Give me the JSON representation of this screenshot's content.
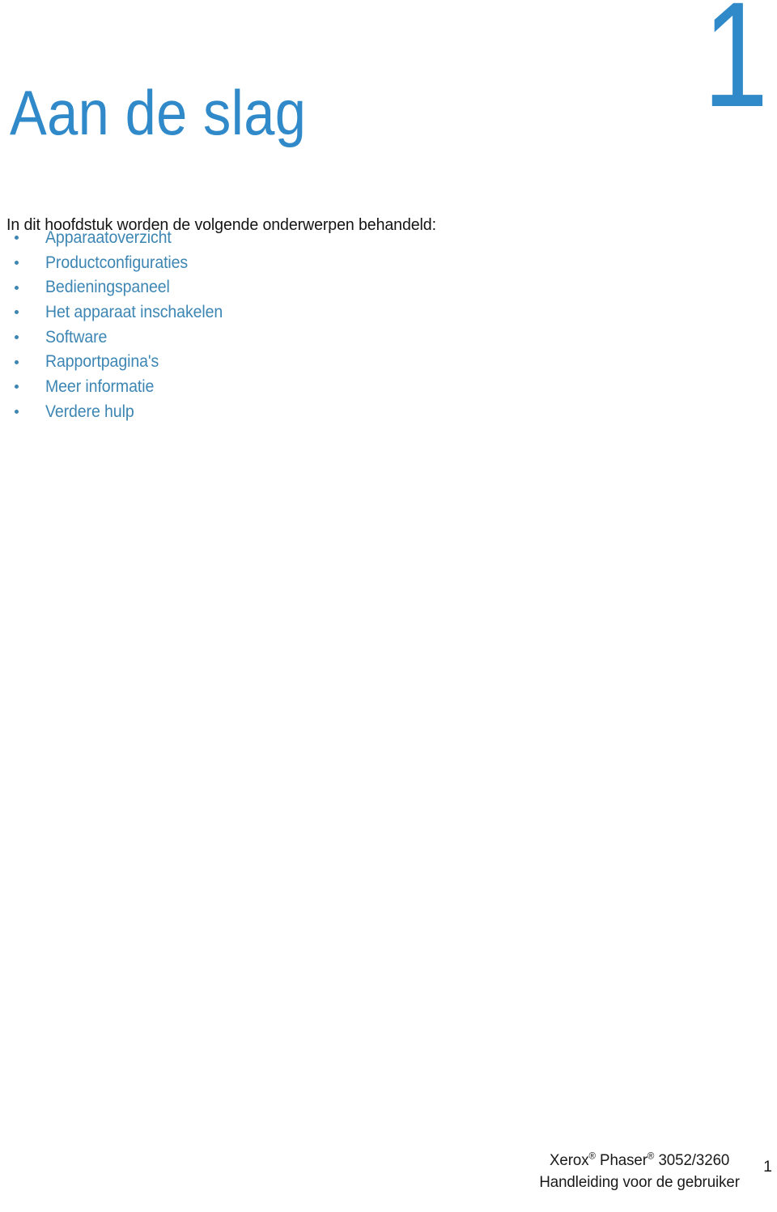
{
  "document": {
    "chapter_number": "1",
    "chapter_title": "Aan de slag",
    "intro_text": "In dit hoofdstuk worden de volgende onderwerpen behandeld:"
  },
  "topics": [
    {
      "label": "Apparaatoverzicht"
    },
    {
      "label": "Productconfiguraties"
    },
    {
      "label": "Bedieningspaneel"
    },
    {
      "label": "Het apparaat inschakelen"
    },
    {
      "label": "Software"
    },
    {
      "label": "Rapportpagina's"
    },
    {
      "label": "Meer informatie"
    },
    {
      "label": "Verdere hulp"
    }
  ],
  "footer": {
    "brand": "Xerox",
    "brand_mark": "®",
    "product_family": " Phaser",
    "product_mark": "®",
    "model": " 3052/3260",
    "subtitle": "Handleiding voor de gebruiker",
    "page_number": "1"
  },
  "colors": {
    "accent_blue": "#3089c8",
    "link_blue": "#3d86b4",
    "body_text": "#141414",
    "background": "#ffffff"
  }
}
